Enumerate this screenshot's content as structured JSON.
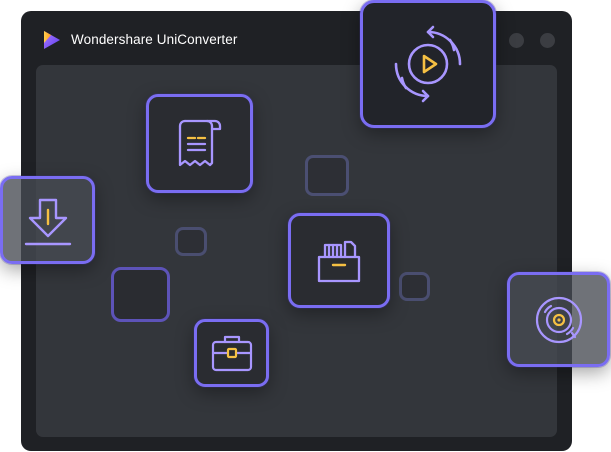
{
  "window": {
    "title": "Wondershare UniConverter"
  },
  "icons": {
    "app_logo": "uniconverter-logo-icon",
    "convert": "convert-video-icon",
    "document": "receipt-document-icon",
    "download": "download-icon",
    "folder": "file-cabinet-icon",
    "toolbox": "toolbox-icon",
    "disc": "dvd-disc-icon"
  },
  "colors": {
    "window_bg": "#1f2125",
    "content_bg": "#33363b",
    "tile_border": "#7a6df2",
    "icon_stroke": "#a896ff",
    "icon_accent": "#f5c043",
    "title_text": "#ffffff"
  }
}
